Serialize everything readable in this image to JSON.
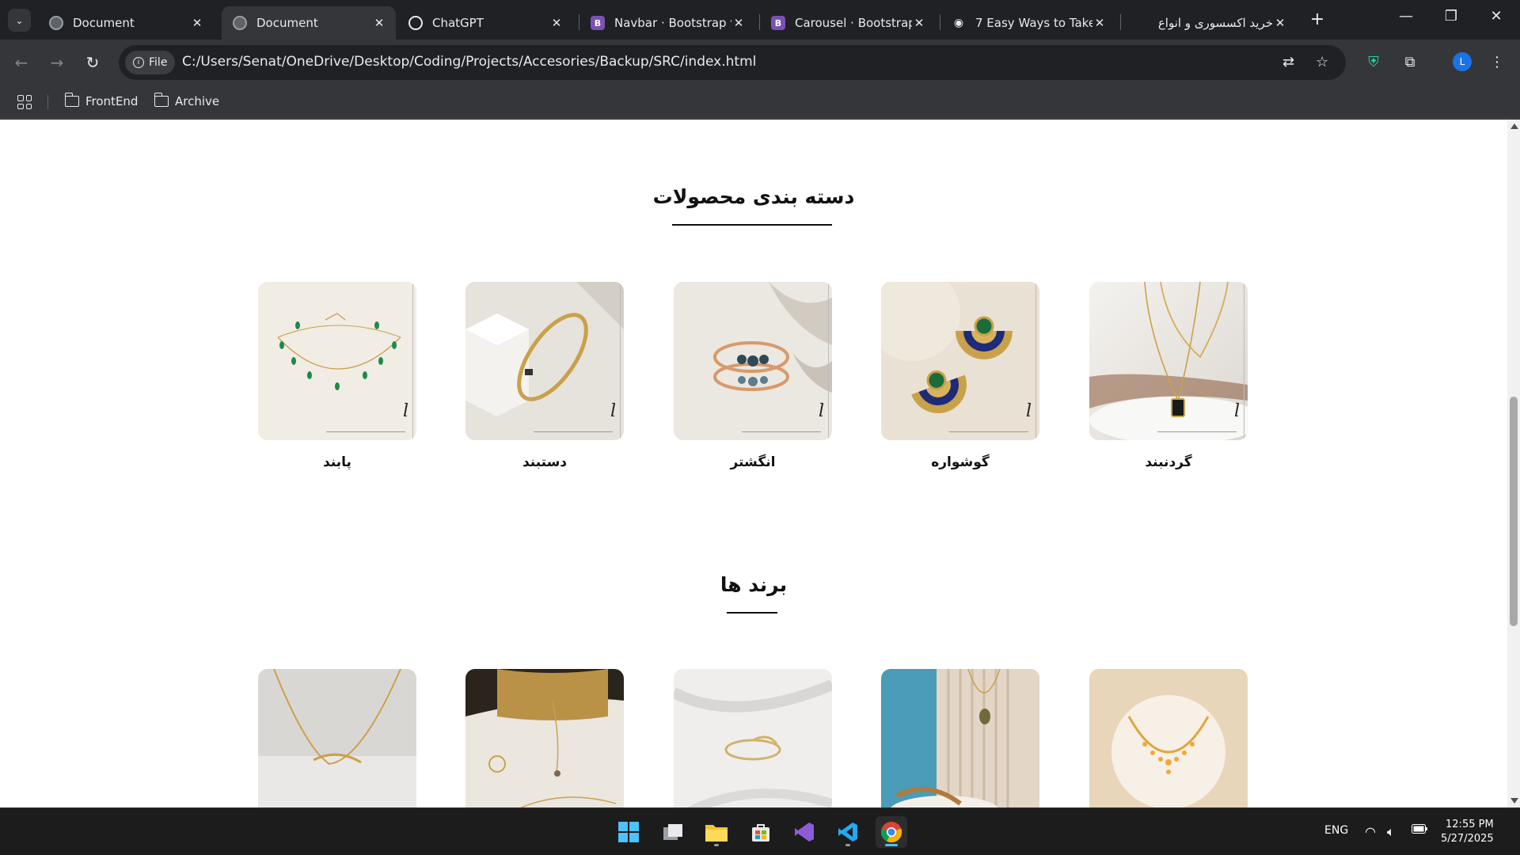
{
  "browser": {
    "tabs": [
      {
        "title": "Document",
        "icon": "globe-icon",
        "active": false
      },
      {
        "title": "Document",
        "icon": "globe-icon",
        "active": true
      },
      {
        "title": "ChatGPT",
        "icon": "chatgpt-icon",
        "active": false
      },
      {
        "title": "Navbar · Bootstrap v",
        "icon": "bootstrap-icon",
        "active": false
      },
      {
        "title": "Carousel · Bootstrap",
        "icon": "bootstrap-icon",
        "active": false
      },
      {
        "title": "7 Easy Ways to Take",
        "icon": "eye-icon",
        "active": false
      },
      {
        "title": "خرید اکسسوری و انواع",
        "icon": "site-icon",
        "active": false
      }
    ],
    "address": {
      "chip_label": "File",
      "url": "C:/Users/Senat/OneDrive/Desktop/Coding/Projects/Accesories/Backup/SRC/index.html"
    },
    "profile_initial": "L",
    "bookmarks": [
      {
        "label": "FrontEnd"
      },
      {
        "label": "Archive"
      }
    ]
  },
  "page": {
    "categories": {
      "title": "دسته بندی محصولات",
      "items": [
        {
          "label": "گردنبند",
          "image": "necklace-photo"
        },
        {
          "label": "گوشواره",
          "image": "earrings-photo"
        },
        {
          "label": "انگشتر",
          "image": "ring-photo"
        },
        {
          "label": "دستبند",
          "image": "bracelet-photo"
        },
        {
          "label": "پابند",
          "image": "anklet-photo"
        }
      ]
    },
    "brands": {
      "title": "برند ها",
      "items": [
        {
          "image": "brand-necklace-pendant-photo"
        },
        {
          "image": "brand-necklace-stand-photo"
        },
        {
          "image": "brand-cuff-photo"
        },
        {
          "image": "brand-chain-photo"
        },
        {
          "image": "brand-ring-necklace-photo"
        }
      ]
    }
  },
  "taskbar": {
    "language": "ENG",
    "time": "12:55 PM",
    "date": "5/27/2025"
  },
  "colors": {
    "browser_dark": "#202124",
    "toolbar": "#35363a",
    "page_bg": "#ffffff",
    "accent_blue": "#4cc2ff"
  }
}
